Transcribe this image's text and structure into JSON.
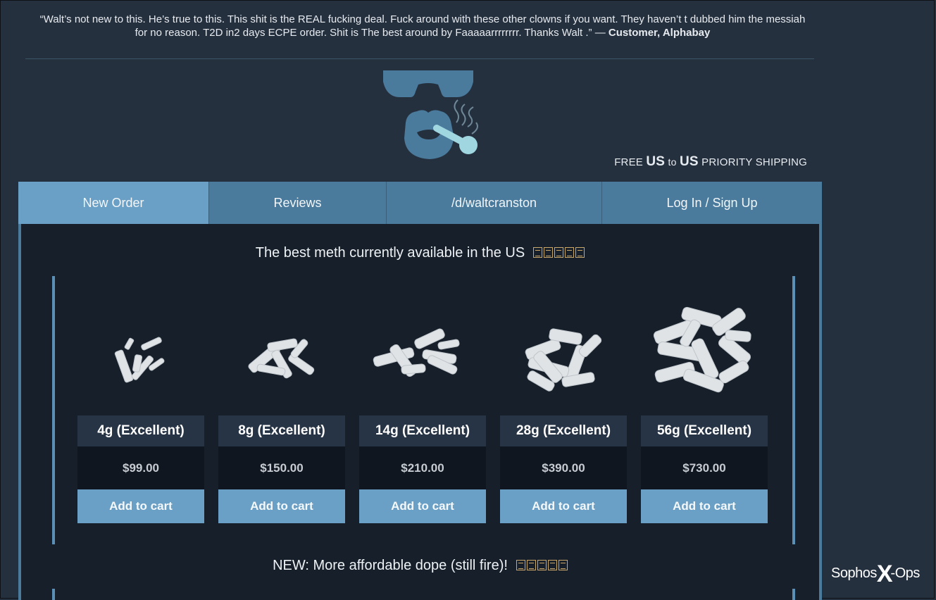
{
  "quote": {
    "text": "“Walt’s not new to this. He’s true to this. This shit is the REAL fucking deal. Fuck around with these other clowns if you want. They haven’t t dubbed him the messiah for no reason. T2D in2 days ECPE order. Shit is The best around by Faaaaarrrrrrrr. Thanks Walt .” —",
    "author": "Customer, Alphabay"
  },
  "shipping": {
    "free": "FREE",
    "us1": "US",
    "to": "to",
    "us2": "US",
    "priority": "PRIORITY SHIPPING"
  },
  "nav": {
    "tabs": [
      {
        "label": "New Order"
      },
      {
        "label": "Reviews"
      },
      {
        "label": "/d/waltcranston"
      },
      {
        "label": "Log In / Sign Up"
      }
    ]
  },
  "main": {
    "heading": "The best meth currently available in the US",
    "products": [
      {
        "title": "4g (Excellent)",
        "price": "$99.00",
        "button": "Add to cart"
      },
      {
        "title": "8g (Excellent)",
        "price": "$150.00",
        "button": "Add to cart"
      },
      {
        "title": "14g (Excellent)",
        "price": "$210.00",
        "button": "Add to cart"
      },
      {
        "title": "28g (Excellent)",
        "price": "$390.00",
        "button": "Add to cart"
      },
      {
        "title": "56g (Excellent)",
        "price": "$730.00",
        "button": "Add to cart"
      }
    ],
    "subheading": "NEW: More affordable dope (still fire)!"
  },
  "watermark": {
    "brand": "Sophos",
    "x": "X",
    "ops": "-Ops"
  },
  "colors": {
    "accent": "#6aa0c5",
    "nav": "#4a7a9c",
    "background": "#25303f",
    "panel": "#161f2a"
  }
}
